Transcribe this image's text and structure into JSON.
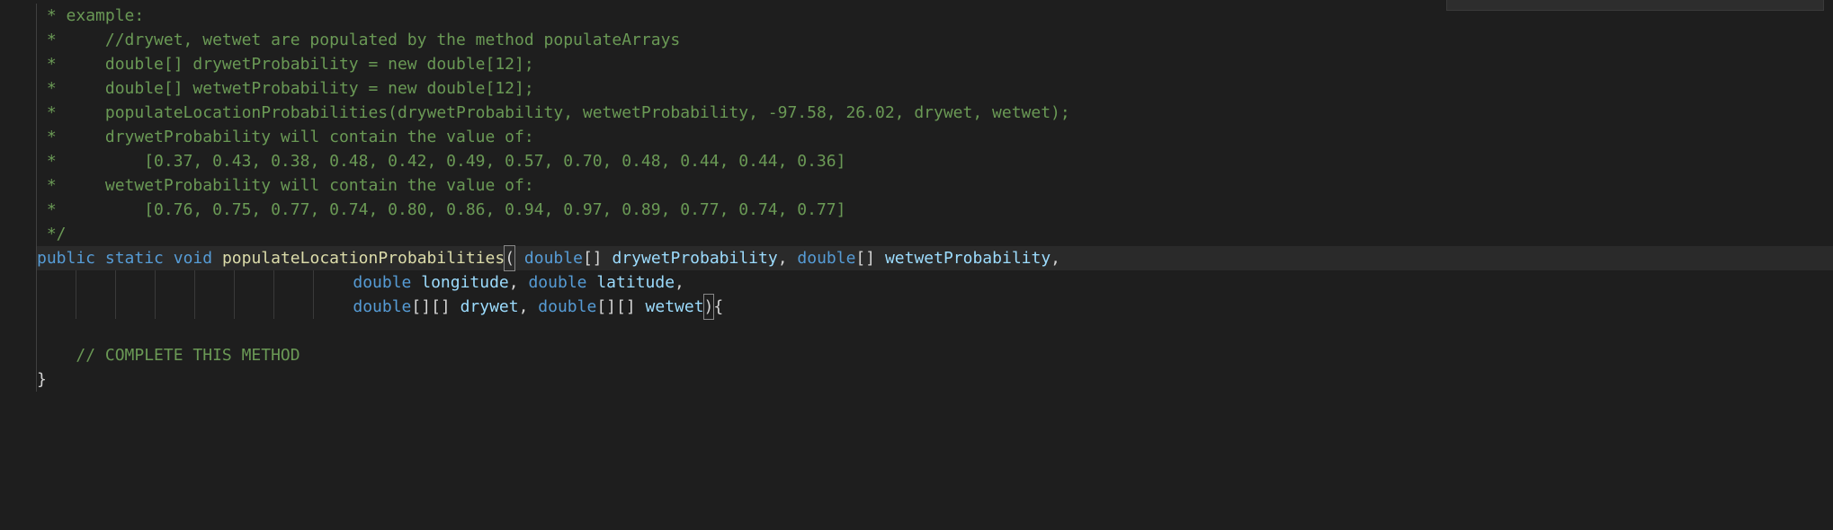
{
  "code": {
    "lines": [
      {
        "indent": 1,
        "tokens": [
          {
            "t": " * ",
            "c": "c-comment"
          },
          {
            "t": "example:",
            "c": "c-comment"
          }
        ]
      },
      {
        "indent": 1,
        "tokens": [
          {
            "t": " *     ",
            "c": "c-comment"
          },
          {
            "t": "//drywet, wetwet are populated by the method populateArrays",
            "c": "c-comment"
          }
        ]
      },
      {
        "indent": 1,
        "tokens": [
          {
            "t": " *     ",
            "c": "c-comment"
          },
          {
            "t": "double[] drywetProbability = new double[12];",
            "c": "c-comment"
          }
        ]
      },
      {
        "indent": 1,
        "tokens": [
          {
            "t": " *     ",
            "c": "c-comment"
          },
          {
            "t": "double[] wetwetProbability = new double[12];",
            "c": "c-comment"
          }
        ]
      },
      {
        "indent": 1,
        "tokens": [
          {
            "t": " *     ",
            "c": "c-comment"
          },
          {
            "t": "populateLocationProbabilities(drywetProbability, wetwetProbability, -97.58, 26.02, drywet, wetwet);",
            "c": "c-comment"
          }
        ]
      },
      {
        "indent": 1,
        "tokens": [
          {
            "t": " *     ",
            "c": "c-comment"
          },
          {
            "t": "drywetProbability will contain the value of:",
            "c": "c-comment"
          }
        ]
      },
      {
        "indent": 1,
        "tokens": [
          {
            "t": " *         ",
            "c": "c-comment"
          },
          {
            "t": "[0.37, 0.43, 0.38, 0.48, 0.42, 0.49, 0.57, 0.70, 0.48, 0.44, 0.44, 0.36]",
            "c": "c-comment"
          }
        ]
      },
      {
        "indent": 1,
        "tokens": [
          {
            "t": " *     ",
            "c": "c-comment"
          },
          {
            "t": "wetwetProbability will contain the value of:",
            "c": "c-comment"
          }
        ]
      },
      {
        "indent": 1,
        "tokens": [
          {
            "t": " *         ",
            "c": "c-comment"
          },
          {
            "t": "[0.76, 0.75, 0.77, 0.74, 0.80, 0.86, 0.94, 0.97, 0.89, 0.77, 0.74, 0.77]",
            "c": "c-comment"
          }
        ]
      },
      {
        "indent": 1,
        "tokens": [
          {
            "t": " */",
            "c": "c-comment"
          }
        ]
      },
      {
        "indent": 1,
        "highlight": true,
        "tokens": [
          {
            "t": "public",
            "c": "c-keyword"
          },
          {
            "t": " ",
            "c": ""
          },
          {
            "t": "static",
            "c": "c-keyword"
          },
          {
            "t": " ",
            "c": ""
          },
          {
            "t": "void",
            "c": "c-type"
          },
          {
            "t": " ",
            "c": ""
          },
          {
            "t": "populateLocationProbabilities",
            "c": "c-func"
          },
          {
            "t": "(",
            "c": "c-paren c-bracket-hl"
          },
          {
            "t": " ",
            "c": ""
          },
          {
            "t": "double",
            "c": "c-type"
          },
          {
            "t": "[] ",
            "c": "c-paren"
          },
          {
            "t": "drywetProbability",
            "c": "c-var"
          },
          {
            "t": ", ",
            "c": "c-paren"
          },
          {
            "t": "double",
            "c": "c-type"
          },
          {
            "t": "[] ",
            "c": "c-paren"
          },
          {
            "t": "wetwetProbability",
            "c": "c-var"
          },
          {
            "t": ", ",
            "c": "c-paren"
          }
        ]
      },
      {
        "indent": 1,
        "guides": 8,
        "leading": "                                    ",
        "tokens": [
          {
            "t": "double",
            "c": "c-type"
          },
          {
            "t": " ",
            "c": ""
          },
          {
            "t": "longitude",
            "c": "c-var"
          },
          {
            "t": ", ",
            "c": "c-paren"
          },
          {
            "t": "double",
            "c": "c-type"
          },
          {
            "t": " ",
            "c": ""
          },
          {
            "t": "latitude",
            "c": "c-var"
          },
          {
            "t": ", ",
            "c": "c-paren"
          }
        ]
      },
      {
        "indent": 1,
        "guides": 8,
        "leading": "                                    ",
        "tokens": [
          {
            "t": "double",
            "c": "c-type"
          },
          {
            "t": "[][] ",
            "c": "c-paren"
          },
          {
            "t": "drywet",
            "c": "c-var"
          },
          {
            "t": ", ",
            "c": "c-paren"
          },
          {
            "t": "double",
            "c": "c-type"
          },
          {
            "t": "[][] ",
            "c": "c-paren"
          },
          {
            "t": "wetwet",
            "c": "c-var"
          },
          {
            "t": ")",
            "c": "c-paren c-bracket-hl"
          },
          {
            "t": "{",
            "c": "c-brace"
          }
        ]
      },
      {
        "indent": 1,
        "tokens": [
          {
            "t": "",
            "c": ""
          }
        ]
      },
      {
        "indent": 1,
        "tokens": [
          {
            "t": "    ",
            "c": ""
          },
          {
            "t": "// COMPLETE THIS METHOD",
            "c": "c-comment"
          }
        ]
      },
      {
        "indent": 1,
        "tokens": [
          {
            "t": "}",
            "c": "c-brace"
          }
        ]
      }
    ]
  }
}
